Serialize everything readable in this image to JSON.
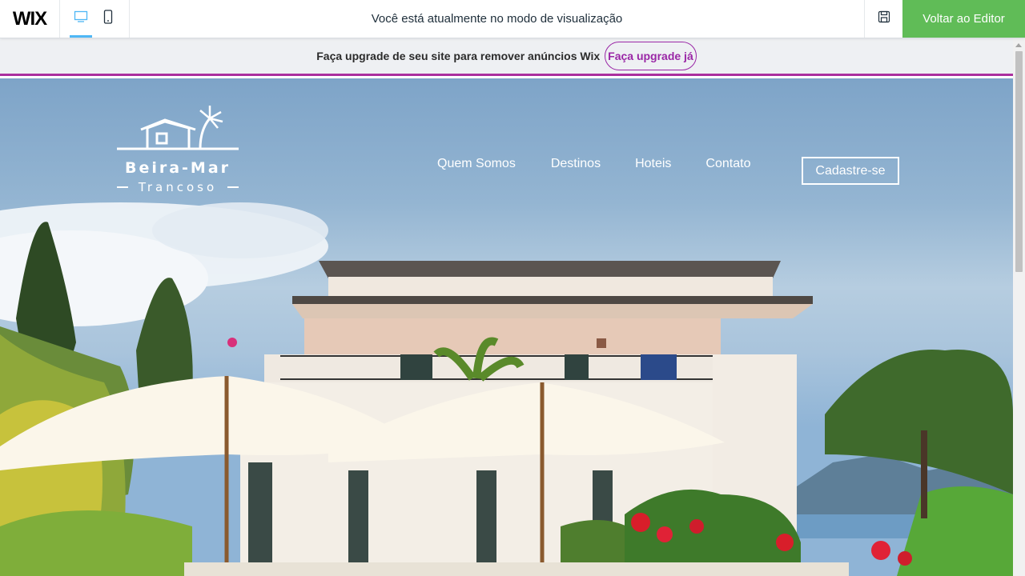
{
  "topbar": {
    "logo_text": "WIX",
    "desktop_icon": "desktop-icon",
    "mobile_icon": "mobile-icon",
    "preview_message": "Você está atualmente no modo de visualização",
    "save_icon": "save-icon",
    "back_to_editor_label": "Voltar ao Editor"
  },
  "upgrade_banner": {
    "text": "Faça upgrade de seu site para remover anúncios Wix",
    "button_label": "Faça upgrade já",
    "accent_color": "#aa2f9e"
  },
  "site": {
    "logo": {
      "icon": "beach-house-palm-icon",
      "name": "Beira-Mar",
      "subtitle": "Trancoso"
    },
    "nav": {
      "items": [
        "Quem Somos",
        "Destinos",
        "Hoteis",
        "Contato"
      ],
      "signup_label": "Cadastre-se"
    }
  },
  "colors": {
    "editor_button": "#60bc57",
    "active_device": "#4eb7f5"
  }
}
